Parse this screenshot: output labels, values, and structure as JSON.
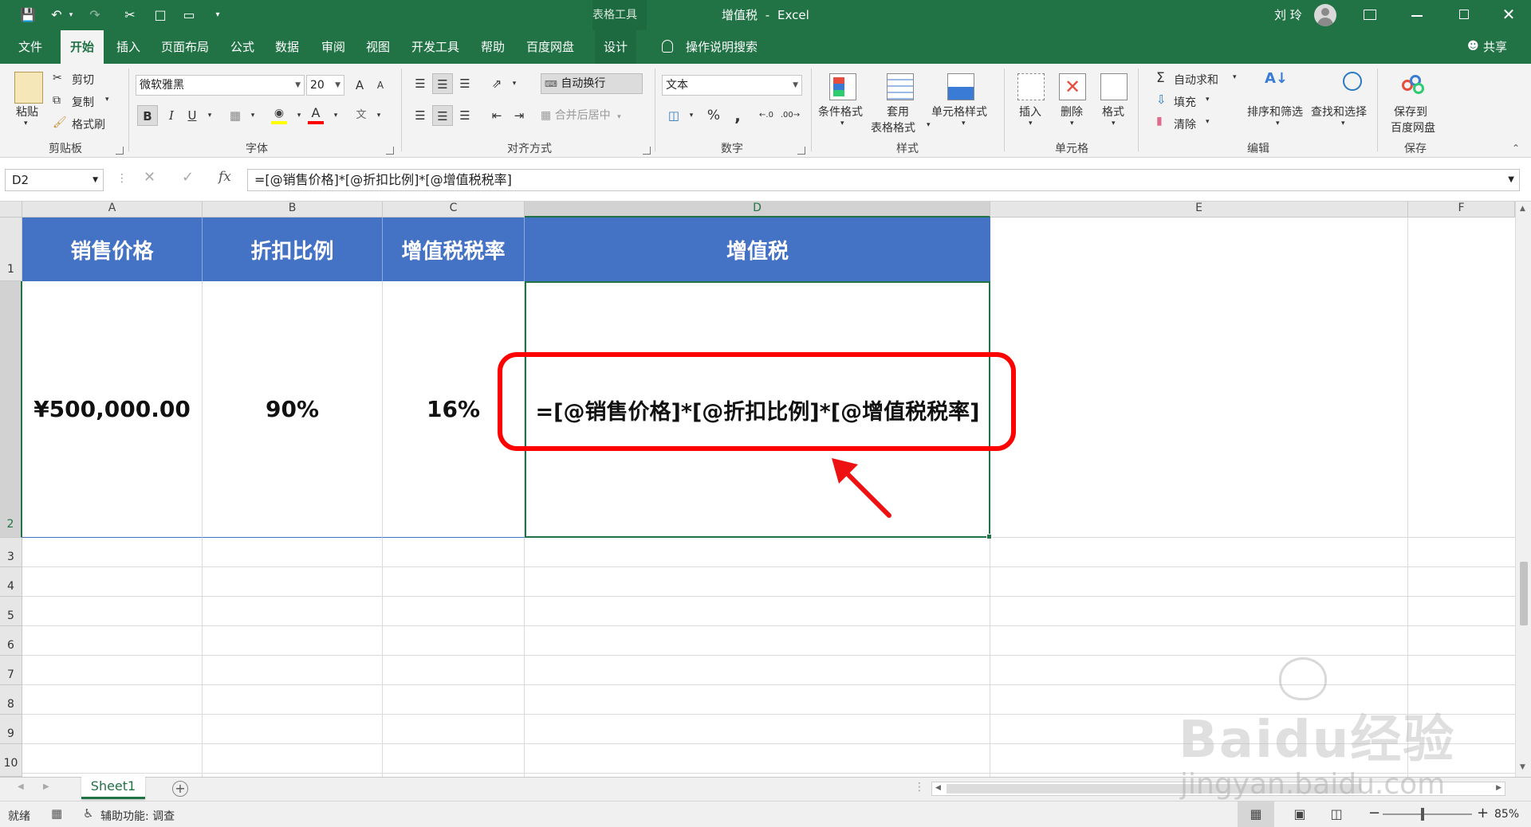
{
  "titlebar": {
    "contextual_tool": "表格工具",
    "document_title": "增值税",
    "separator": "-",
    "app_name": "Excel",
    "user_name": "刘 玲"
  },
  "tabs": [
    "文件",
    "开始",
    "插入",
    "页面布局",
    "公式",
    "数据",
    "审阅",
    "视图",
    "开发工具",
    "帮助",
    "百度网盘",
    "设计"
  ],
  "tell_me": "操作说明搜索",
  "share": "共享",
  "ribbon": {
    "clipboard": {
      "paste": "粘贴",
      "cut": "剪切",
      "copy": "复制",
      "format_painter": "格式刷",
      "label": "剪贴板"
    },
    "font": {
      "name": "微软雅黑",
      "size": "20",
      "bold": "B",
      "italic": "I",
      "underline": "U",
      "label": "字体",
      "font_color_letter": "A",
      "grow": "A",
      "shrink": "A"
    },
    "alignment": {
      "wrap_text": "自动换行",
      "merge_center": "合并后居中",
      "label": "对齐方式"
    },
    "number": {
      "format": "文本",
      "percent": "%",
      "comma": ",",
      "label": "数字"
    },
    "styles": {
      "conditional": "条件格式",
      "table_fmt_1": "套用",
      "table_fmt_2": "表格格式",
      "cell_styles": "单元格样式",
      "label": "样式"
    },
    "cells": {
      "insert": "插入",
      "delete": "删除",
      "format": "格式",
      "label": "单元格"
    },
    "editing": {
      "autosum": "自动求和",
      "fill": "填充",
      "clear": "清除",
      "sort_filter": "排序和筛选",
      "find_select": "查找和选择",
      "label": "编辑"
    },
    "save": {
      "save_to_1": "保存到",
      "save_to_2": "百度网盘",
      "label": "保存"
    }
  },
  "formula_bar": {
    "name_box": "D2",
    "fx": "fx",
    "formula": "=[@销售价格]*[@折扣比例]*[@增值税税率]"
  },
  "columns": [
    "A",
    "B",
    "C",
    "D",
    "E",
    "F"
  ],
  "rows": [
    "1",
    "2",
    "3",
    "4",
    "5",
    "6",
    "7",
    "8",
    "9",
    "10"
  ],
  "table": {
    "headers": [
      "销售价格",
      "折扣比例",
      "增值税税率",
      "增值税"
    ],
    "row": [
      "¥500,000.00",
      "90%",
      "16%",
      "=[@销售价格]*[@折扣比例]*[@增值税税率]"
    ]
  },
  "sheets": [
    "Sheet1"
  ],
  "status": {
    "ready": "就绪",
    "accessibility": "辅助功能: 调查",
    "zoom": "85%",
    "minus": "−",
    "plus": "+"
  },
  "watermark": {
    "brand": "Baidu经验",
    "url": "jingyan.baidu.com"
  },
  "colors": {
    "excel_green": "#217346",
    "table_header": "#4472c4",
    "highlight": "#ff0000"
  }
}
